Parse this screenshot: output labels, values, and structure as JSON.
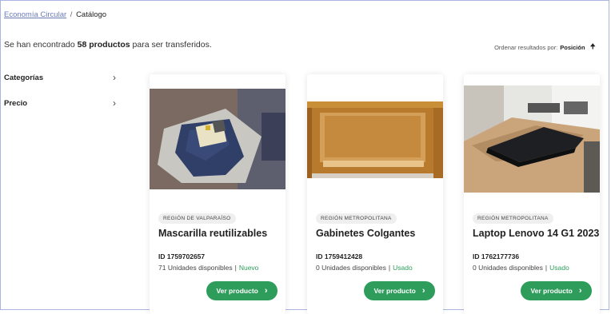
{
  "breadcrumb": {
    "link": "Economía Circular",
    "separator": "/",
    "current": "Catálogo"
  },
  "results": {
    "prefix": "Se han encontrado",
    "count": "58 productos",
    "suffix": "para ser transferidos."
  },
  "sort": {
    "label": "Ordenar resultados por:",
    "value": "Posición",
    "direction_icon": "arrow-up-icon"
  },
  "filters": [
    {
      "label": "Categorías",
      "icon": "chevron-right-icon"
    },
    {
      "label": "Precio",
      "icon": "chevron-right-icon"
    }
  ],
  "products": [
    {
      "region": "REGIÓN DE VALPARAÍSO",
      "title": "Mascarilla reutilizables",
      "id": "ID 1759702657",
      "availability": "71 Unidades disponibles",
      "condition": "Nuevo",
      "button": "Ver producto"
    },
    {
      "region": "REGIÓN METROPOLITANA",
      "title": "Gabinetes Colgantes",
      "id": "ID 1759412428",
      "availability": "0 Unidades disponibles",
      "condition": "Usado",
      "button": "Ver producto"
    },
    {
      "region": "REGIÓN METROPOLITANA",
      "title": "Laptop Lenovo 14 G1 2023",
      "id": "ID 1762177736",
      "availability": "0 Unidades disponibles",
      "condition": "Usado",
      "button": "Ver producto"
    }
  ],
  "colors": {
    "accent": "#2e9d5b",
    "link": "#6b7bb8",
    "border": "#aab4e0"
  }
}
